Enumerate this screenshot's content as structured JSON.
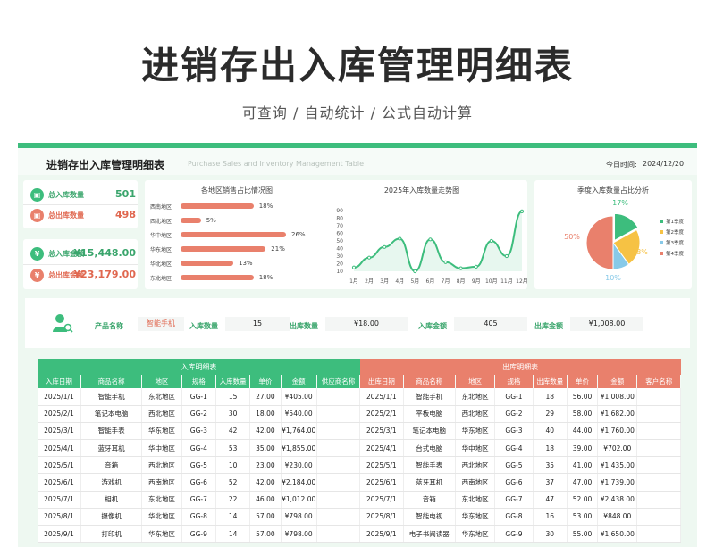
{
  "hero": {
    "title": "进销存出入库管理明细表",
    "subtitle": "可查询 / 自动统计 / 公式自动计算"
  },
  "sheet": {
    "title": "进销存出入库管理明细表",
    "subtitle_en": "Purchase Sales and Inventory Management Table",
    "date_label": "今日时间:",
    "date_value": "2024/12/20"
  },
  "kpi": [
    {
      "label": "总入库数量",
      "value": "501",
      "color": "#3dbd7d",
      "icon": "box-in-icon"
    },
    {
      "label": "总出库数量",
      "value": "498",
      "color": "#e9806c",
      "icon": "box-out-icon"
    },
    {
      "label": "总入库金额",
      "value": "¥15,448.00",
      "color": "#3dbd7d",
      "icon": "money-in-icon"
    },
    {
      "label": "总出库金额",
      "value": "¥23,179.00",
      "color": "#e9806c",
      "icon": "money-out-icon"
    }
  ],
  "chart_data": [
    {
      "type": "bar",
      "title": "各地区销售占比情况图",
      "orientation": "horizontal",
      "categories": [
        "西南地区",
        "西北地区",
        "华中地区",
        "华东地区",
        "华北地区",
        "东北地区"
      ],
      "values": [
        18,
        5,
        26,
        21,
        13,
        18
      ],
      "value_labels": [
        "18%",
        "5%",
        "26%",
        "21%",
        "13%",
        "18%"
      ],
      "unit": "%",
      "color": "#e9806c"
    },
    {
      "type": "line",
      "title": "2025年入库数量走势图",
      "categories": [
        "1月",
        "2月",
        "3月",
        "4月",
        "5月",
        "6月",
        "7月",
        "8月",
        "9月",
        "10月",
        "11月",
        "12月"
      ],
      "values": [
        15,
        28,
        42,
        53,
        10,
        52,
        22,
        14,
        16,
        50,
        30,
        89
      ],
      "ylim": [
        10,
        90
      ],
      "yticks": [
        "10",
        "20",
        "30",
        "40",
        "50",
        "60",
        "70",
        "80",
        "90"
      ],
      "color": "#3dbd7d"
    },
    {
      "type": "pie",
      "title": "季度入库数量占比分析",
      "categories": [
        "第1季度",
        "第2季度",
        "第3季度",
        "第4季度"
      ],
      "values": [
        17,
        23,
        10,
        50
      ],
      "value_labels": [
        "17%",
        "23%",
        "10%",
        "50%"
      ],
      "colors": [
        "#3dbd7d",
        "#f6c244",
        "#87c9e8",
        "#e9806c"
      ]
    }
  ],
  "info": {
    "product_label": "产品名称",
    "product_value": "智能手机",
    "in_qty_label": "入库数量",
    "in_qty_value": "15",
    "out_qty_label": "出库数量",
    "out_qty_value": "¥18.00",
    "in_amt_label": "入库金额",
    "in_amt_value": "405",
    "out_amt_label": "出库金额",
    "out_amt_value": "¥1,008.00"
  },
  "tables": {
    "in_title": "入库明细表",
    "out_title": "出库明细表",
    "in_headers": [
      "入库日期",
      "商品名称",
      "地区",
      "规格",
      "入库数量",
      "单价",
      "金额",
      "供应商名称"
    ],
    "out_headers": [
      "出库日期",
      "商品名称",
      "地区",
      "规格",
      "出库数量",
      "单价",
      "金额",
      "客户名称"
    ],
    "rows": [
      {
        "in": [
          "2025/1/1",
          "智能手机",
          "东北地区",
          "GG-1",
          "15",
          "27.00",
          "¥405.00",
          ""
        ],
        "out": [
          "2025/1/1",
          "智能手机",
          "东北地区",
          "GG-1",
          "18",
          "56.00",
          "¥1,008.00",
          ""
        ]
      },
      {
        "in": [
          "2025/2/1",
          "笔记本电脑",
          "西北地区",
          "GG-2",
          "30",
          "18.00",
          "¥540.00",
          ""
        ],
        "out": [
          "2025/2/1",
          "平板电脑",
          "西北地区",
          "GG-2",
          "29",
          "58.00",
          "¥1,682.00",
          ""
        ]
      },
      {
        "in": [
          "2025/3/1",
          "智能手表",
          "华东地区",
          "GG-3",
          "42",
          "42.00",
          "¥1,764.00",
          ""
        ],
        "out": [
          "2025/3/1",
          "笔记本电脑",
          "华东地区",
          "GG-3",
          "40",
          "44.00",
          "¥1,760.00",
          ""
        ]
      },
      {
        "in": [
          "2025/4/1",
          "蓝牙耳机",
          "华中地区",
          "GG-4",
          "53",
          "35.00",
          "¥1,855.00",
          ""
        ],
        "out": [
          "2025/4/1",
          "台式电脑",
          "华中地区",
          "GG-4",
          "18",
          "39.00",
          "¥702.00",
          ""
        ]
      },
      {
        "in": [
          "2025/5/1",
          "音箱",
          "西北地区",
          "GG-5",
          "10",
          "23.00",
          "¥230.00",
          ""
        ],
        "out": [
          "2025/5/1",
          "智能手表",
          "西北地区",
          "GG-5",
          "35",
          "41.00",
          "¥1,435.00",
          ""
        ]
      },
      {
        "in": [
          "2025/6/1",
          "游戏机",
          "西南地区",
          "GG-6",
          "52",
          "42.00",
          "¥2,184.00",
          ""
        ],
        "out": [
          "2025/6/1",
          "蓝牙耳机",
          "西南地区",
          "GG-6",
          "37",
          "47.00",
          "¥1,739.00",
          ""
        ]
      },
      {
        "in": [
          "2025/7/1",
          "相机",
          "东北地区",
          "GG-7",
          "22",
          "46.00",
          "¥1,012.00",
          ""
        ],
        "out": [
          "2025/7/1",
          "音箱",
          "东北地区",
          "GG-7",
          "47",
          "52.00",
          "¥2,438.00",
          ""
        ]
      },
      {
        "in": [
          "2025/8/1",
          "摄像机",
          "华北地区",
          "GG-8",
          "14",
          "57.00",
          "¥798.00",
          ""
        ],
        "out": [
          "2025/8/1",
          "智能电视",
          "华东地区",
          "GG-8",
          "16",
          "53.00",
          "¥848.00",
          ""
        ]
      },
      {
        "in": [
          "2025/9/1",
          "打印机",
          "华东地区",
          "GG-9",
          "14",
          "57.00",
          "¥798.00",
          ""
        ],
        "out": [
          "2025/9/1",
          "电子书阅读器",
          "华东地区",
          "GG-9",
          "30",
          "55.00",
          "¥1,650.00",
          ""
        ]
      }
    ]
  }
}
